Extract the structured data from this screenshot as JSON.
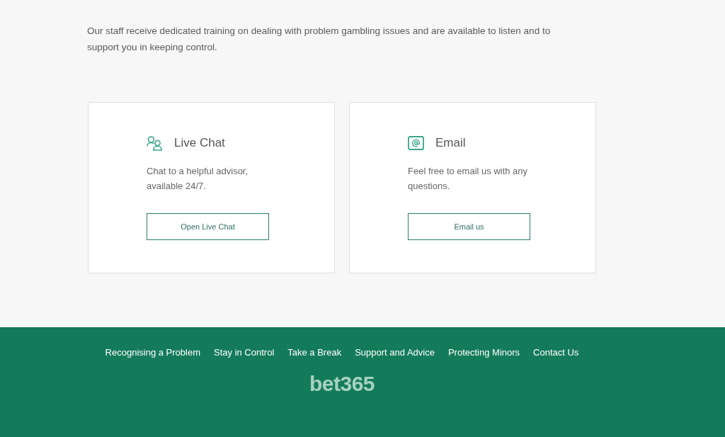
{
  "intro": "Our staff receive dedicated training on dealing with problem gambling issues and are available to listen and to support you in keeping control.",
  "contact_cards": [
    {
      "kind": "chat",
      "title": "Live Chat",
      "description": "Chat to a helpful advisor, available 24/7.",
      "button": "Open Live Chat"
    },
    {
      "kind": "email",
      "title": "Email",
      "description": "Feel free to email us with any questions.",
      "button": "Email us"
    }
  ],
  "footer": {
    "links": [
      "Recognising a Problem",
      "Stay in Control",
      "Take a Break",
      "Support and Advice",
      "Protecting Minors",
      "Contact Us"
    ],
    "logo": "bet365"
  }
}
